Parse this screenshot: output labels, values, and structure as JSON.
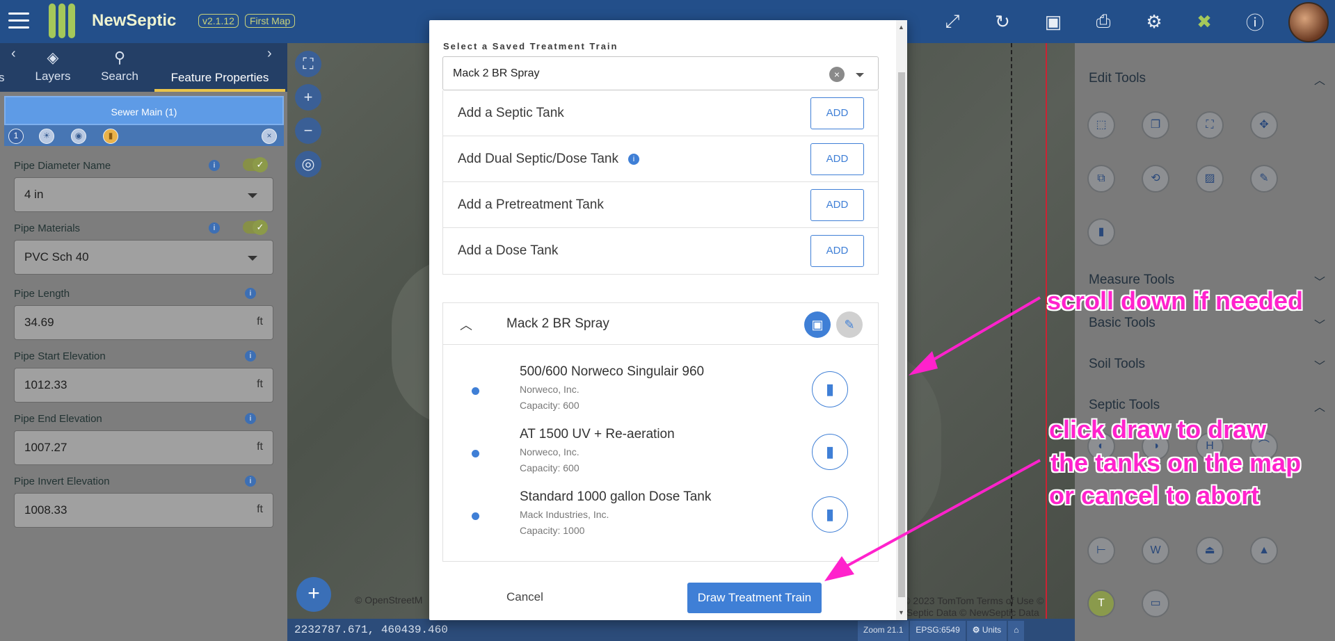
{
  "app": {
    "name": "NewSeptic",
    "version": "v2.1.12",
    "map_name": "First Map"
  },
  "toolbar_icons": [
    "share-icon",
    "refresh-icon",
    "save-icon",
    "print-icon",
    "settings-icon",
    "tools-icon",
    "info-icon"
  ],
  "left_panel": {
    "tabs": [
      {
        "label": "s",
        "icon": "partial"
      },
      {
        "label": "Layers",
        "icon": "layers-icon"
      },
      {
        "label": "Search",
        "icon": "search-icon"
      },
      {
        "label": "Feature Properties",
        "icon": "none",
        "active": true
      }
    ],
    "feature_header": "Sewer Main (1)",
    "feature_count": "1",
    "fields": [
      {
        "label": "Pipe Diameter Name",
        "value": "4 in",
        "type": "select"
      },
      {
        "label": "Pipe Materials",
        "value": "PVC Sch 40",
        "type": "select"
      },
      {
        "label": "Pipe Length",
        "value": "34.69",
        "unit": "ft"
      },
      {
        "label": "Pipe Start Elevation",
        "value": "1012.33",
        "unit": "ft"
      },
      {
        "label": "Pipe End Elevation",
        "value": "1007.27",
        "unit": "ft"
      },
      {
        "label": "Pipe Invert Elevation",
        "value": "1008.33",
        "unit": "ft"
      }
    ]
  },
  "map": {
    "coords": "2232787.671, 460439.460",
    "zoom": "Zoom 21.1",
    "epsg": "EPSG:6549",
    "units": "Units",
    "attribution_left": "© OpenStreetM",
    "attribution_right_1": "S © 2023 TomTom Terms of Use ©",
    "attribution_right_2": "ewSeptic Data © NewSeptic Data"
  },
  "right_panel": {
    "sections": [
      {
        "label": "Edit Tools",
        "state": "open"
      },
      {
        "label": "Measure Tools",
        "state": "closed"
      },
      {
        "label": "Basic Tools",
        "state": "closed"
      },
      {
        "label": "Soil Tools",
        "state": "closed"
      },
      {
        "label": "Septic Tools",
        "state": "open"
      }
    ]
  },
  "modal": {
    "title": "Select a Saved Treatment Train",
    "selected": "Mack 2 BR Spray",
    "add_rows": [
      {
        "label": "Add a Septic Tank",
        "button": "ADD",
        "info": false
      },
      {
        "label": "Add Dual Septic/Dose Tank",
        "button": "ADD",
        "info": true
      },
      {
        "label": "Add a Pretreatment Tank",
        "button": "ADD",
        "info": false
      },
      {
        "label": "Add a Dose Tank",
        "button": "ADD",
        "info": false
      }
    ],
    "train_name": "Mack 2 BR Spray",
    "tanks": [
      {
        "name": "500/600 Norweco Singulair 960",
        "manufacturer": "Norweco, Inc.",
        "capacity": "Capacity: 600"
      },
      {
        "name": "AT 1500 UV + Re-aeration",
        "manufacturer": "Norweco, Inc.",
        "capacity": "Capacity: 600"
      },
      {
        "name": "Standard 1000 gallon Dose Tank",
        "manufacturer": "Mack Industries, Inc.",
        "capacity": "Capacity: 1000"
      }
    ],
    "cancel_label": "Cancel",
    "draw_label": "Draw Treatment Train"
  },
  "annotations": {
    "scroll": "scroll down if needed",
    "draw_line1": "click draw to draw",
    "draw_line2": "the tanks on the map",
    "draw_line3": "or cancel to abort",
    "color": "#ff22cc"
  }
}
